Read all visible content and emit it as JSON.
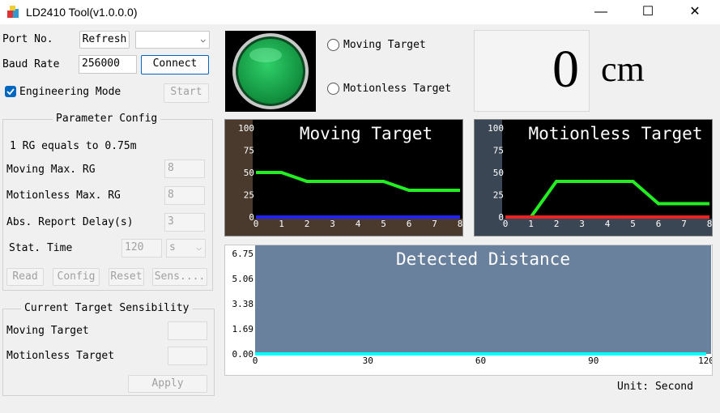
{
  "window": {
    "title": "LD2410 Tool(v1.0.0.0)",
    "minimize": "—",
    "maximize": "☐",
    "close": "✕"
  },
  "conn": {
    "port_label": "Port No.",
    "refresh_label": "Refresh",
    "port_value": "",
    "baud_label": "Baud Rate",
    "baud_value": "256000",
    "connect_label": "Connect",
    "engineering_label": "Engineering Mode",
    "engineering_checked": true,
    "start_label": "Start"
  },
  "param": {
    "title": "Parameter Config",
    "rg_note": "1 RG equals to 0.75m",
    "moving_max_label": "Moving Max. RG",
    "moving_max_value": "8",
    "motionless_max_label": "Motionless Max. RG",
    "motionless_max_value": "8",
    "delay_label": "Abs. Report Delay(s)",
    "delay_value": "3",
    "stat_label": "Stat. Time",
    "stat_value": "120",
    "stat_unit": "s",
    "read_label": "Read",
    "config_label": "Config",
    "reset_label": "Reset",
    "sens_label": "Sens...."
  },
  "sens": {
    "title": "Current Target Sensibility",
    "moving_label": "Moving Target",
    "moving_value": "",
    "motionless_label": "Motionless Target",
    "motionless_value": "",
    "apply_label": "Apply"
  },
  "status": {
    "moving_radio": "Moving Target",
    "motionless_radio": "Motionless Target",
    "distance_value": "0",
    "distance_unit": "cm",
    "indicator_color": "#1aa84a"
  },
  "footer": {
    "unit_text": "Unit:  Second"
  },
  "chart_data": [
    {
      "type": "line",
      "title": "Moving Target",
      "x": [
        0,
        1,
        2,
        3,
        4,
        5,
        6,
        7,
        8
      ],
      "ylim": [
        0,
        100
      ],
      "yticks": [
        0,
        25,
        50,
        75,
        100
      ],
      "series": [
        {
          "color": "#22ee22",
          "values": [
            50,
            50,
            40,
            40,
            40,
            40,
            30,
            30,
            30
          ]
        },
        {
          "color": "#2222ff",
          "values": [
            0,
            0,
            0,
            0,
            0,
            0,
            0,
            0,
            0
          ]
        }
      ]
    },
    {
      "type": "line",
      "title": "Motionless Target",
      "x": [
        0,
        1,
        2,
        3,
        4,
        5,
        6,
        7,
        8
      ],
      "ylim": [
        0,
        100
      ],
      "yticks": [
        0,
        25,
        50,
        75,
        100
      ],
      "series": [
        {
          "color": "#22ee22",
          "values": [
            0,
            0,
            40,
            40,
            40,
            40,
            15,
            15,
            15
          ]
        },
        {
          "color": "#ee2222",
          "values": [
            0,
            0,
            0,
            0,
            0,
            0,
            0,
            0,
            0
          ]
        }
      ]
    },
    {
      "type": "line",
      "title": "Detected Distance",
      "x": [
        0,
        120
      ],
      "xticks": [
        0,
        30,
        60,
        90,
        120
      ],
      "ylim": [
        0,
        6.75
      ],
      "yticks": [
        "0.00",
        "1.69",
        "3.38",
        "5.06",
        "6.75"
      ],
      "series": [
        {
          "color": "#00ffff",
          "values": [
            0,
            0
          ]
        }
      ]
    }
  ]
}
